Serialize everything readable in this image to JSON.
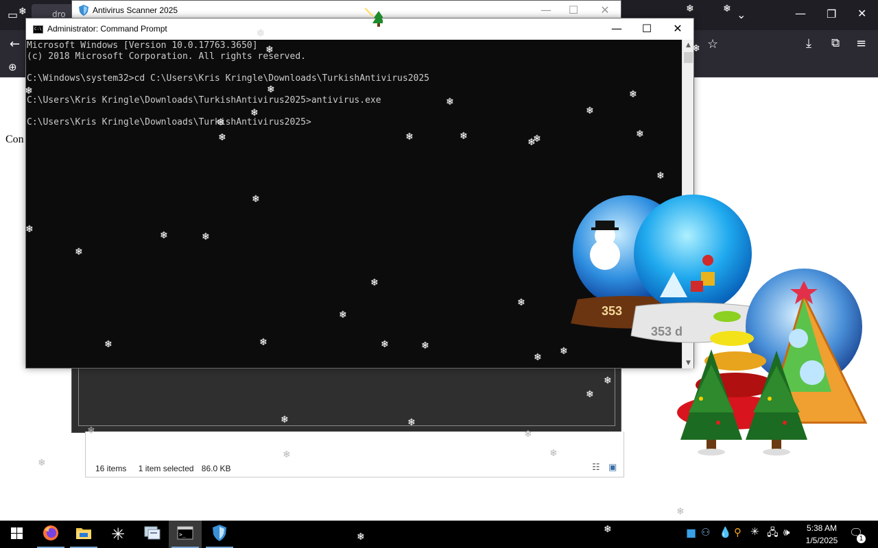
{
  "browser": {
    "tab_label": "dro",
    "page_text": "Con"
  },
  "av_window": {
    "title": "Antivirus Scanner 2025"
  },
  "explorer": {
    "items_count": "16 items",
    "selection": "1 item selected",
    "size": "86.0 KB"
  },
  "cmd": {
    "title": "Administrator: Command Prompt",
    "lines": [
      "Microsoft Windows [Version 10.0.17763.3650]",
      "(c) 2018 Microsoft Corporation. All rights reserved.",
      "",
      "C:\\Windows\\system32>cd C:\\Users\\Kris Kringle\\Downloads\\TurkishAntivirus2025",
      "",
      "C:\\Users\\Kris Kringle\\Downloads\\TurkishAntivirus2025>antivirus.exe",
      "",
      "C:\\Users\\Kris Kringle\\Downloads\\TurkishAntivirus2025>"
    ]
  },
  "decoration": {
    "globe_days_1": "353",
    "globe_days_2": "353 d"
  },
  "taskbar": {
    "time": "5:38 AM",
    "date": "1/5/2025",
    "notification_count": "1"
  },
  "colors": {
    "console_bg": "#0c0c0c",
    "console_text": "#cccccc",
    "taskbar_bg": "#000000",
    "browser_chrome": "#2b2a33"
  }
}
